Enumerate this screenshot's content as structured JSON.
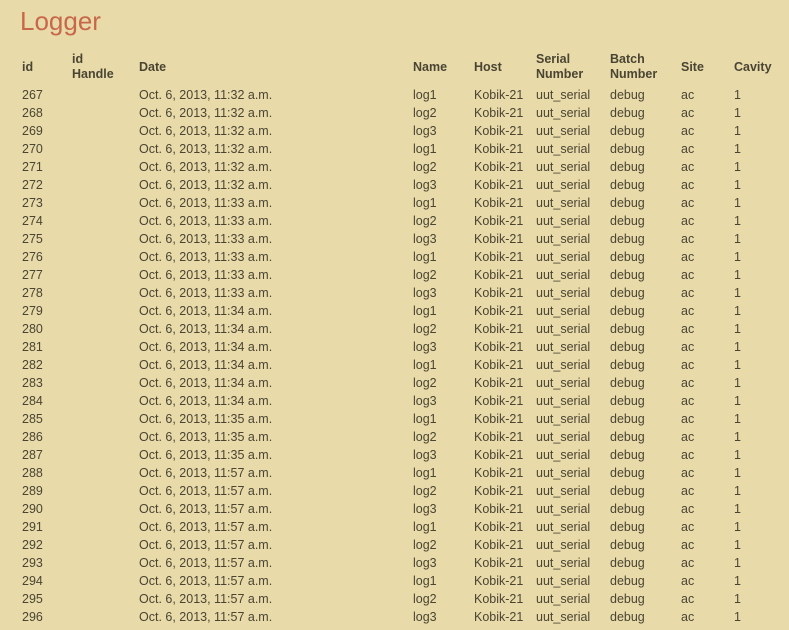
{
  "page": {
    "title": "Logger"
  },
  "colors": {
    "background": "#e8dba9",
    "title": "#c8684a",
    "text": "#4a4433"
  },
  "table": {
    "headers": [
      "id",
      "id Handle",
      "Date",
      "Name",
      "Host",
      "Serial Number",
      "Batch Number",
      "Site",
      "Cavity"
    ],
    "rows": [
      [
        "267",
        "",
        "Oct. 6, 2013, 11:32 a.m.",
        "log1",
        "Kobik-21",
        "uut_serial",
        "debug",
        "ac",
        "1"
      ],
      [
        "268",
        "",
        "Oct. 6, 2013, 11:32 a.m.",
        "log2",
        "Kobik-21",
        "uut_serial",
        "debug",
        "ac",
        "1"
      ],
      [
        "269",
        "",
        "Oct. 6, 2013, 11:32 a.m.",
        "log3",
        "Kobik-21",
        "uut_serial",
        "debug",
        "ac",
        "1"
      ],
      [
        "270",
        "",
        "Oct. 6, 2013, 11:32 a.m.",
        "log1",
        "Kobik-21",
        "uut_serial",
        "debug",
        "ac",
        "1"
      ],
      [
        "271",
        "",
        "Oct. 6, 2013, 11:32 a.m.",
        "log2",
        "Kobik-21",
        "uut_serial",
        "debug",
        "ac",
        "1"
      ],
      [
        "272",
        "",
        "Oct. 6, 2013, 11:32 a.m.",
        "log3",
        "Kobik-21",
        "uut_serial",
        "debug",
        "ac",
        "1"
      ],
      [
        "273",
        "",
        "Oct. 6, 2013, 11:33 a.m.",
        "log1",
        "Kobik-21",
        "uut_serial",
        "debug",
        "ac",
        "1"
      ],
      [
        "274",
        "",
        "Oct. 6, 2013, 11:33 a.m.",
        "log2",
        "Kobik-21",
        "uut_serial",
        "debug",
        "ac",
        "1"
      ],
      [
        "275",
        "",
        "Oct. 6, 2013, 11:33 a.m.",
        "log3",
        "Kobik-21",
        "uut_serial",
        "debug",
        "ac",
        "1"
      ],
      [
        "276",
        "",
        "Oct. 6, 2013, 11:33 a.m.",
        "log1",
        "Kobik-21",
        "uut_serial",
        "debug",
        "ac",
        "1"
      ],
      [
        "277",
        "",
        "Oct. 6, 2013, 11:33 a.m.",
        "log2",
        "Kobik-21",
        "uut_serial",
        "debug",
        "ac",
        "1"
      ],
      [
        "278",
        "",
        "Oct. 6, 2013, 11:33 a.m.",
        "log3",
        "Kobik-21",
        "uut_serial",
        "debug",
        "ac",
        "1"
      ],
      [
        "279",
        "",
        "Oct. 6, 2013, 11:34 a.m.",
        "log1",
        "Kobik-21",
        "uut_serial",
        "debug",
        "ac",
        "1"
      ],
      [
        "280",
        "",
        "Oct. 6, 2013, 11:34 a.m.",
        "log2",
        "Kobik-21",
        "uut_serial",
        "debug",
        "ac",
        "1"
      ],
      [
        "281",
        "",
        "Oct. 6, 2013, 11:34 a.m.",
        "log3",
        "Kobik-21",
        "uut_serial",
        "debug",
        "ac",
        "1"
      ],
      [
        "282",
        "",
        "Oct. 6, 2013, 11:34 a.m.",
        "log1",
        "Kobik-21",
        "uut_serial",
        "debug",
        "ac",
        "1"
      ],
      [
        "283",
        "",
        "Oct. 6, 2013, 11:34 a.m.",
        "log2",
        "Kobik-21",
        "uut_serial",
        "debug",
        "ac",
        "1"
      ],
      [
        "284",
        "",
        "Oct. 6, 2013, 11:34 a.m.",
        "log3",
        "Kobik-21",
        "uut_serial",
        "debug",
        "ac",
        "1"
      ],
      [
        "285",
        "",
        "Oct. 6, 2013, 11:35 a.m.",
        "log1",
        "Kobik-21",
        "uut_serial",
        "debug",
        "ac",
        "1"
      ],
      [
        "286",
        "",
        "Oct. 6, 2013, 11:35 a.m.",
        "log2",
        "Kobik-21",
        "uut_serial",
        "debug",
        "ac",
        "1"
      ],
      [
        "287",
        "",
        "Oct. 6, 2013, 11:35 a.m.",
        "log3",
        "Kobik-21",
        "uut_serial",
        "debug",
        "ac",
        "1"
      ],
      [
        "288",
        "",
        "Oct. 6, 2013, 11:57 a.m.",
        "log1",
        "Kobik-21",
        "uut_serial",
        "debug",
        "ac",
        "1"
      ],
      [
        "289",
        "",
        "Oct. 6, 2013, 11:57 a.m.",
        "log2",
        "Kobik-21",
        "uut_serial",
        "debug",
        "ac",
        "1"
      ],
      [
        "290",
        "",
        "Oct. 6, 2013, 11:57 a.m.",
        "log3",
        "Kobik-21",
        "uut_serial",
        "debug",
        "ac",
        "1"
      ],
      [
        "291",
        "",
        "Oct. 6, 2013, 11:57 a.m.",
        "log1",
        "Kobik-21",
        "uut_serial",
        "debug",
        "ac",
        "1"
      ],
      [
        "292",
        "",
        "Oct. 6, 2013, 11:57 a.m.",
        "log2",
        "Kobik-21",
        "uut_serial",
        "debug",
        "ac",
        "1"
      ],
      [
        "293",
        "",
        "Oct. 6, 2013, 11:57 a.m.",
        "log3",
        "Kobik-21",
        "uut_serial",
        "debug",
        "ac",
        "1"
      ],
      [
        "294",
        "",
        "Oct. 6, 2013, 11:57 a.m.",
        "log1",
        "Kobik-21",
        "uut_serial",
        "debug",
        "ac",
        "1"
      ],
      [
        "295",
        "",
        "Oct. 6, 2013, 11:57 a.m.",
        "log2",
        "Kobik-21",
        "uut_serial",
        "debug",
        "ac",
        "1"
      ],
      [
        "296",
        "",
        "Oct. 6, 2013, 11:57 a.m.",
        "log3",
        "Kobik-21",
        "uut_serial",
        "debug",
        "ac",
        "1"
      ]
    ]
  }
}
